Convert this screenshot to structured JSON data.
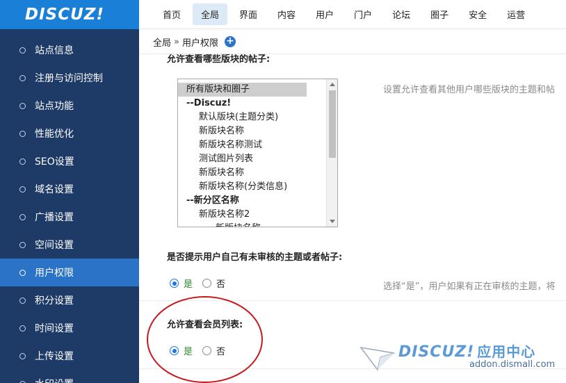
{
  "logo": {
    "text": "DISCUZ!"
  },
  "topnav": {
    "items": [
      {
        "label": "首页",
        "active": false
      },
      {
        "label": "全局",
        "active": true
      },
      {
        "label": "界面",
        "active": false
      },
      {
        "label": "内容",
        "active": false
      },
      {
        "label": "用户",
        "active": false
      },
      {
        "label": "门户",
        "active": false
      },
      {
        "label": "论坛",
        "active": false
      },
      {
        "label": "圈子",
        "active": false
      },
      {
        "label": "安全",
        "active": false
      },
      {
        "label": "运营",
        "active": false
      }
    ]
  },
  "sidebar": {
    "items": [
      {
        "label": "站点信息",
        "active": false
      },
      {
        "label": "注册与访问控制",
        "active": false
      },
      {
        "label": "站点功能",
        "active": false
      },
      {
        "label": "性能优化",
        "active": false
      },
      {
        "label": "SEO设置",
        "active": false
      },
      {
        "label": "域名设置",
        "active": false
      },
      {
        "label": "广播设置",
        "active": false
      },
      {
        "label": "空间设置",
        "active": false
      },
      {
        "label": "用户权限",
        "active": true
      },
      {
        "label": "积分设置",
        "active": false
      },
      {
        "label": "时间设置",
        "active": false
      },
      {
        "label": "上传设置",
        "active": false
      },
      {
        "label": "水印设置",
        "active": false
      }
    ]
  },
  "breadcrumb": {
    "root": "全局",
    "separator": "»",
    "current": "用户权限",
    "add_icon": "plus-circle-icon"
  },
  "forum_view": {
    "label": "允许查看哪些版块的帖子:",
    "options": [
      {
        "label": "所有版块和圈子",
        "level": 0,
        "bold": false,
        "selected": true
      },
      {
        "label": "--Discuz!",
        "level": 0,
        "bold": true,
        "selected": false
      },
      {
        "label": "默认版块(主题分类)",
        "level": 1,
        "bold": false,
        "selected": false
      },
      {
        "label": "新版块名称",
        "level": 1,
        "bold": false,
        "selected": false
      },
      {
        "label": "新版块名称测试",
        "level": 1,
        "bold": false,
        "selected": false
      },
      {
        "label": "测试图片列表",
        "level": 1,
        "bold": false,
        "selected": false
      },
      {
        "label": "新版块名称",
        "level": 1,
        "bold": false,
        "selected": false
      },
      {
        "label": "新版块名称(分类信息)",
        "level": 1,
        "bold": false,
        "selected": false
      },
      {
        "label": "--新分区名称",
        "level": 0,
        "bold": true,
        "selected": false
      },
      {
        "label": "新版块名称2",
        "level": 1,
        "bold": false,
        "selected": false
      },
      {
        "label": "新版块名称",
        "level": 2,
        "bold": false,
        "selected": false
      }
    ],
    "tip": "设置允许查看其他用户哪些版块的主题和帖"
  },
  "unaudited_prompt": {
    "label": "是否提示用户自己有未审核的主题或者帖子:",
    "yes": "是",
    "no": "否",
    "value": "yes",
    "tip": "选择“是”，用户如果有正在审核的主题，将"
  },
  "member_list": {
    "label": "允许查看会员列表:",
    "yes": "是",
    "no": "否",
    "value": "yes"
  },
  "watermark": {
    "title": "DISCUZ!",
    "subtitle": "应用中心",
    "url": "addon.dismall.com"
  },
  "colors": {
    "sidebar_bg": "#1e3a66",
    "sidebar_active": "#2b73c7",
    "logo_bg": "#1a7fd6",
    "annotation_red": "#c8181e"
  }
}
